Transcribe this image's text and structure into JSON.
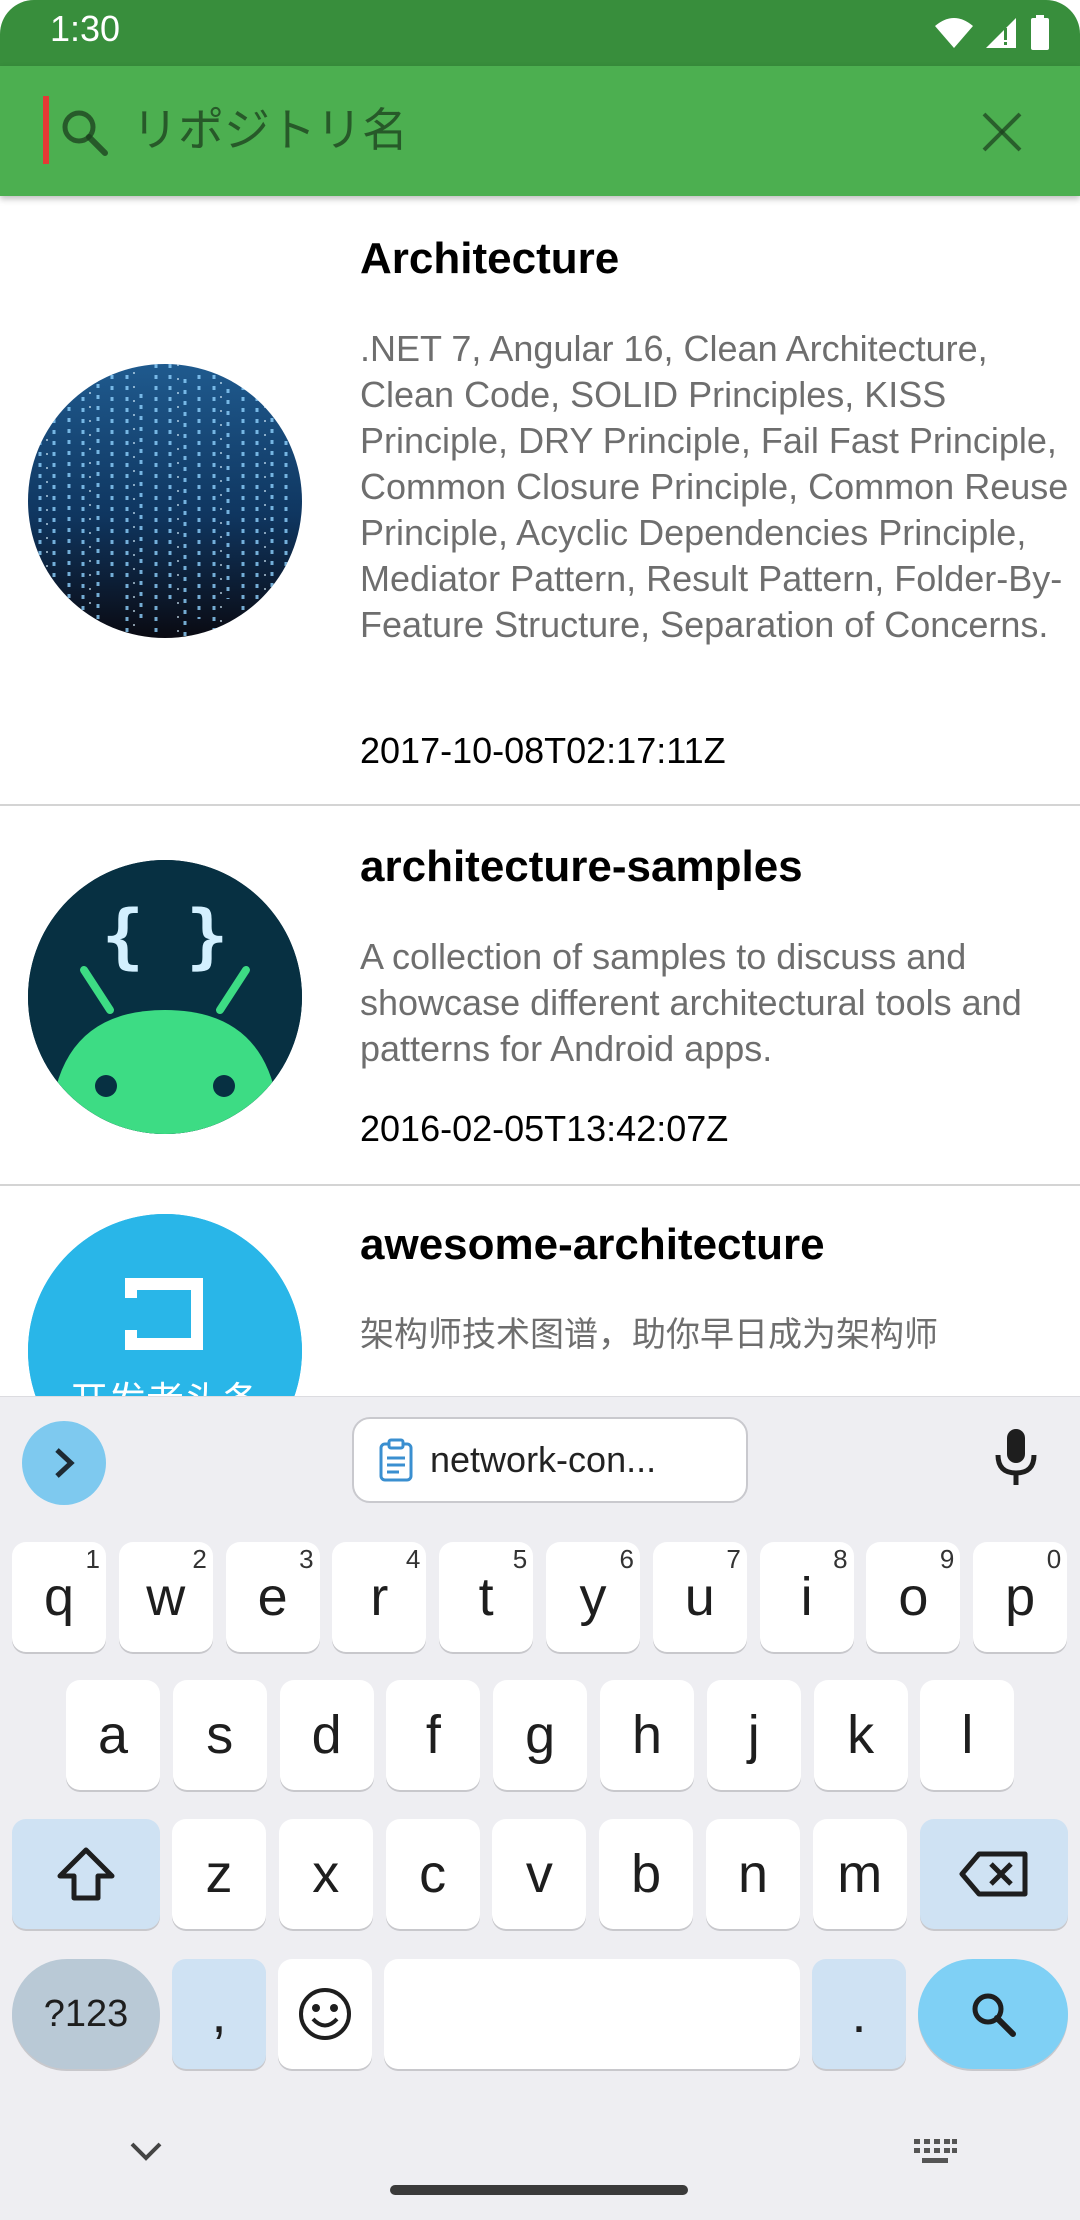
{
  "status_bar": {
    "time": "1:30"
  },
  "search": {
    "placeholder": "リポジトリ名",
    "value": ""
  },
  "repos": [
    {
      "name": "Architecture",
      "description": ".NET 7, Angular 16, Clean Architecture, Clean Code, SOLID Principles, KISS Principle, DRY Principle, Fail Fast Principle, Common Closure Principle, Common Reuse Principle, Acyclic Dependencies Principle, Mediator Pattern, Result Pattern, Folder-By-Feature Structure, Separation of Concerns.",
      "date": "2017-10-08T02:17:11Z",
      "avatar": "matrix-code-avatar"
    },
    {
      "name": "architecture-samples",
      "description": "A collection of samples to discuss and showcase different architectural tools and patterns for Android apps.",
      "date": "2016-02-05T13:42:07Z",
      "avatar": "android-avatar",
      "avatar_text": "{ }"
    },
    {
      "name": "awesome-architecture",
      "description": "架构师技术图谱，助你早日成为架构师",
      "avatar": "developer-avatar",
      "avatar_text": "开发者头条"
    }
  ],
  "keyboard": {
    "clipboard_text": "network-con...",
    "row1": [
      {
        "k": "q",
        "s": "1"
      },
      {
        "k": "w",
        "s": "2"
      },
      {
        "k": "e",
        "s": "3"
      },
      {
        "k": "r",
        "s": "4"
      },
      {
        "k": "t",
        "s": "5"
      },
      {
        "k": "y",
        "s": "6"
      },
      {
        "k": "u",
        "s": "7"
      },
      {
        "k": "i",
        "s": "8"
      },
      {
        "k": "o",
        "s": "9"
      },
      {
        "k": "p",
        "s": "0"
      }
    ],
    "row2": [
      "a",
      "s",
      "d",
      "f",
      "g",
      "h",
      "j",
      "k",
      "l"
    ],
    "row3": [
      "z",
      "x",
      "c",
      "v",
      "b",
      "n",
      "m"
    ],
    "symbols_label": "?123",
    "comma": ",",
    "period": "."
  },
  "colors": {
    "status_bar": "#388e3c",
    "toolbar": "#4caf50",
    "cursor": "#e53935",
    "keyboard_bg": "#eeeef2",
    "action_key": "#7fd0f5"
  }
}
